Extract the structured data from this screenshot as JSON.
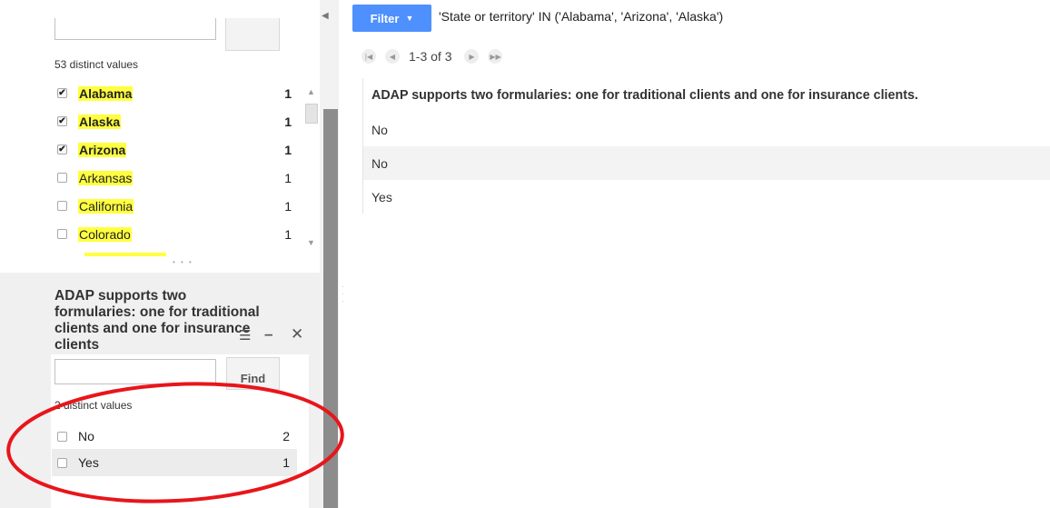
{
  "facet_state": {
    "distinct_count_label": "53 distinct values",
    "items": [
      {
        "label": "Alabama",
        "count": "1",
        "checked": true
      },
      {
        "label": "Alaska",
        "count": "1",
        "checked": true
      },
      {
        "label": "Arizona",
        "count": "1",
        "checked": true
      },
      {
        "label": "Arkansas",
        "count": "1",
        "checked": false
      },
      {
        "label": "California",
        "count": "1",
        "checked": false
      },
      {
        "label": "Colorado",
        "count": "1",
        "checked": false
      }
    ]
  },
  "facet_adap": {
    "title": "ADAP supports two formularies: one for traditional clients and one for insurance clients",
    "find_label": "Find",
    "find_value": "",
    "distinct_count_label": "2 distinct values",
    "items": [
      {
        "label": "No",
        "count": "2",
        "checked": false
      },
      {
        "label": "Yes",
        "count": "1",
        "checked": false
      }
    ]
  },
  "toolbar": {
    "filter_label": "Filter",
    "filter_expression": "'State or territory' IN ('Alabama', 'Arizona', 'Alaska')",
    "pager_text": "1-3 of 3"
  },
  "table": {
    "header": "ADAP supports two formularies: one for traditional clients and one for insurance clients.",
    "rows": [
      "No",
      "No",
      "Yes"
    ]
  },
  "annotation": {
    "color": "#e8151b"
  }
}
